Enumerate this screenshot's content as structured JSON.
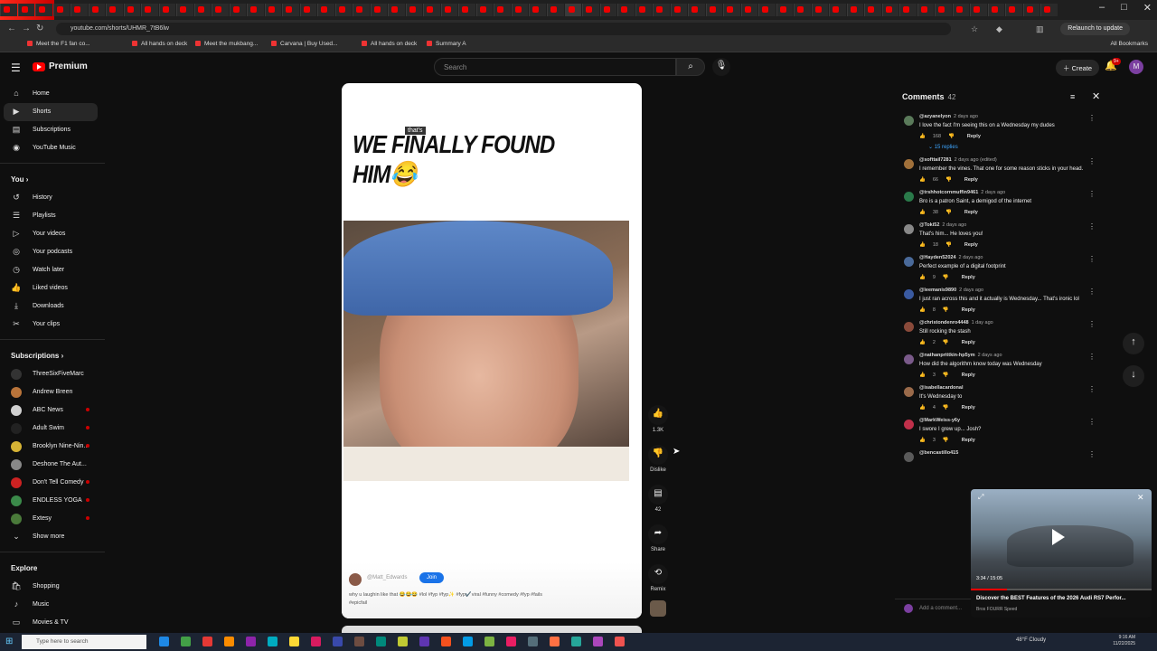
{
  "browser": {
    "url": "youtube.com/shorts/UHMR_7tB6lw",
    "relaunch_label": "Relaunch to update",
    "all_bookmarks_label": "All Bookmarks",
    "bookmarks": [
      "Meet the F1 fan co...",
      "All hands on deck",
      "Meet the mukbang...",
      "Carvana | Buy Used...",
      "All hands on deck",
      "Summary A"
    ]
  },
  "header": {
    "logo_text": "Premium",
    "search_placeholder": "Search",
    "create_label": "Create",
    "notification_badge": "9+",
    "avatar_letter": "M"
  },
  "sidebar": {
    "main": [
      {
        "label": "Home",
        "icon": "home-icon",
        "glyph": "⌂"
      },
      {
        "label": "Shorts",
        "icon": "shorts-icon",
        "glyph": "▶"
      },
      {
        "label": "Subscriptions",
        "icon": "subscriptions-icon",
        "glyph": "▤"
      },
      {
        "label": "YouTube Music",
        "icon": "music-icon",
        "glyph": "◉"
      }
    ],
    "you_header": "You",
    "you": [
      {
        "label": "History",
        "icon": "history-icon",
        "glyph": "↺"
      },
      {
        "label": "Playlists",
        "icon": "playlists-icon",
        "glyph": "☰"
      },
      {
        "label": "Your videos",
        "icon": "your-videos-icon",
        "glyph": "▷"
      },
      {
        "label": "Your podcasts",
        "icon": "podcasts-icon",
        "glyph": "◎"
      },
      {
        "label": "Watch later",
        "icon": "watch-later-icon",
        "glyph": "◷"
      },
      {
        "label": "Liked videos",
        "icon": "liked-icon",
        "glyph": "👍"
      },
      {
        "label": "Downloads",
        "icon": "downloads-icon",
        "glyph": "⤓"
      },
      {
        "label": "Your clips",
        "icon": "clips-icon",
        "glyph": "✂"
      }
    ],
    "subscriptions_header": "Subscriptions",
    "subscriptions": [
      {
        "label": "ThreeSixFiveMarc",
        "color": "#333333",
        "live": false
      },
      {
        "label": "Andrew Breen",
        "color": "#b9743a",
        "live": false
      },
      {
        "label": "ABC News",
        "color": "#d0d0d0",
        "live": true
      },
      {
        "label": "Adult Swim",
        "color": "#222222",
        "live": true
      },
      {
        "label": "Brooklyn Nine-Nin...",
        "color": "#d6b335",
        "live": true
      },
      {
        "label": "Deshone The Aut...",
        "color": "#888888",
        "live": false
      },
      {
        "label": "Don't Tell Comedy",
        "color": "#cc2222",
        "live": true
      },
      {
        "label": "ENDLESS YOGA",
        "color": "#3b8a4a",
        "live": true
      },
      {
        "label": "Extesy",
        "color": "#4a7a3a",
        "live": true
      }
    ],
    "show_more_label": "Show more",
    "explore_header": "Explore",
    "explore": [
      {
        "label": "Shopping",
        "icon": "shopping-icon",
        "glyph": "🛍"
      },
      {
        "label": "Music",
        "icon": "music-note-icon",
        "glyph": "♪"
      },
      {
        "label": "Movies & TV",
        "icon": "movies-icon",
        "glyph": "▭"
      },
      {
        "label": "Live",
        "icon": "live-icon",
        "glyph": "◉"
      }
    ]
  },
  "short": {
    "title_text": "WE FINALLY FOUND HIM😂",
    "subtitle_overlay": "that's",
    "channel_name": "@Matt_Edwards",
    "join_label": "Join",
    "caption": "why u laughin like that 😂😂😂 #lol #fyp #fyp✨ #fyp✔️viral #funny #comedy #fyp #fails #epicfail"
  },
  "actions": {
    "like_count": "1.3K",
    "dislike_label": "Dislike",
    "comments_count": "42",
    "share_label": "Share",
    "remix_label": "Remix"
  },
  "comments": {
    "title": "Comments",
    "count": "42",
    "add_placeholder": "Add a comment...",
    "items": [
      {
        "author": "@azyanelyon",
        "ago": "2 days ago",
        "text": "I love the fact I'm seeing this on a Wednesday my dudes",
        "likes": "168",
        "color": "#5a7a5a",
        "replies": "15 replies"
      },
      {
        "author": "@softtail7281",
        "ago": "2 days ago (edited)",
        "text": "I remember the vines. That one for some reason sticks in your head.",
        "likes": "66",
        "color": "#a0703a",
        "replies": ""
      },
      {
        "author": "@trshhotcornmuffin9461",
        "ago": "2 days ago",
        "text": "Bro is a patron Saint, a demigod of the internet",
        "likes": "38",
        "color": "#2a7a4a",
        "replies": ""
      },
      {
        "author": "@Toki52",
        "ago": "2 days ago",
        "text": "That's him... He loves you!",
        "likes": "18",
        "color": "#888888",
        "replies": ""
      },
      {
        "author": "@Hayden52024",
        "ago": "2 days ago",
        "text": "Perfect example of a digital footprint",
        "likes": "9",
        "color": "#4a6a9a",
        "replies": ""
      },
      {
        "author": "@leemanis9890",
        "ago": "2 days ago",
        "text": "I just ran across this and it actually is Wednesday... That's ironic lol",
        "likes": "8",
        "color": "#3a5aa0",
        "replies": ""
      },
      {
        "author": "@christondenro4448",
        "ago": "1 day ago",
        "text": "Still rocking the stash",
        "likes": "2",
        "color": "#8a4a3a",
        "replies": ""
      },
      {
        "author": "@nathanprittkin-hp5ym",
        "ago": "2 days ago",
        "text": "How did the algorithm know today was Wednesday",
        "likes": "3",
        "color": "#7a5a8a",
        "replies": ""
      },
      {
        "author": "@isabellacardonal",
        "ago": "",
        "text": "It's Wednesday to",
        "likes": "4",
        "color": "#9a6a4a",
        "replies": ""
      },
      {
        "author": "@MarkWeiss-y6y",
        "ago": "",
        "text": "I swore I grew up... Josh?",
        "likes": "3",
        "color": "#c0304a",
        "replies": ""
      },
      {
        "author": "@bencastillo415",
        "ago": "",
        "text": "",
        "likes": "",
        "color": "#5a5a5a",
        "replies": ""
      }
    ]
  },
  "miniplayer": {
    "time": "3:34 / 15:05",
    "title": "Discover the BEST Features of the 2026 Audi RS7 Perfor...",
    "channel": "Bros FOURR Speed"
  },
  "taskbar": {
    "search_placeholder": "Type here to search",
    "weather": "48°F Cloudy",
    "time": "9:16 AM",
    "date": "11/22/2025",
    "icon_colors": [
      "#1e88e5",
      "#43a047",
      "#e53935",
      "#fb8c00",
      "#8e24aa",
      "#00acc1",
      "#fdd835",
      "#d81b60",
      "#3949ab",
      "#6d4c41",
      "#00897b",
      "#c0ca33",
      "#5e35b1",
      "#f4511e",
      "#039be5",
      "#7cb342",
      "#e91e63",
      "#546e7a",
      "#ff7043",
      "#26a69a",
      "#ab47bc",
      "#ef5350"
    ]
  }
}
